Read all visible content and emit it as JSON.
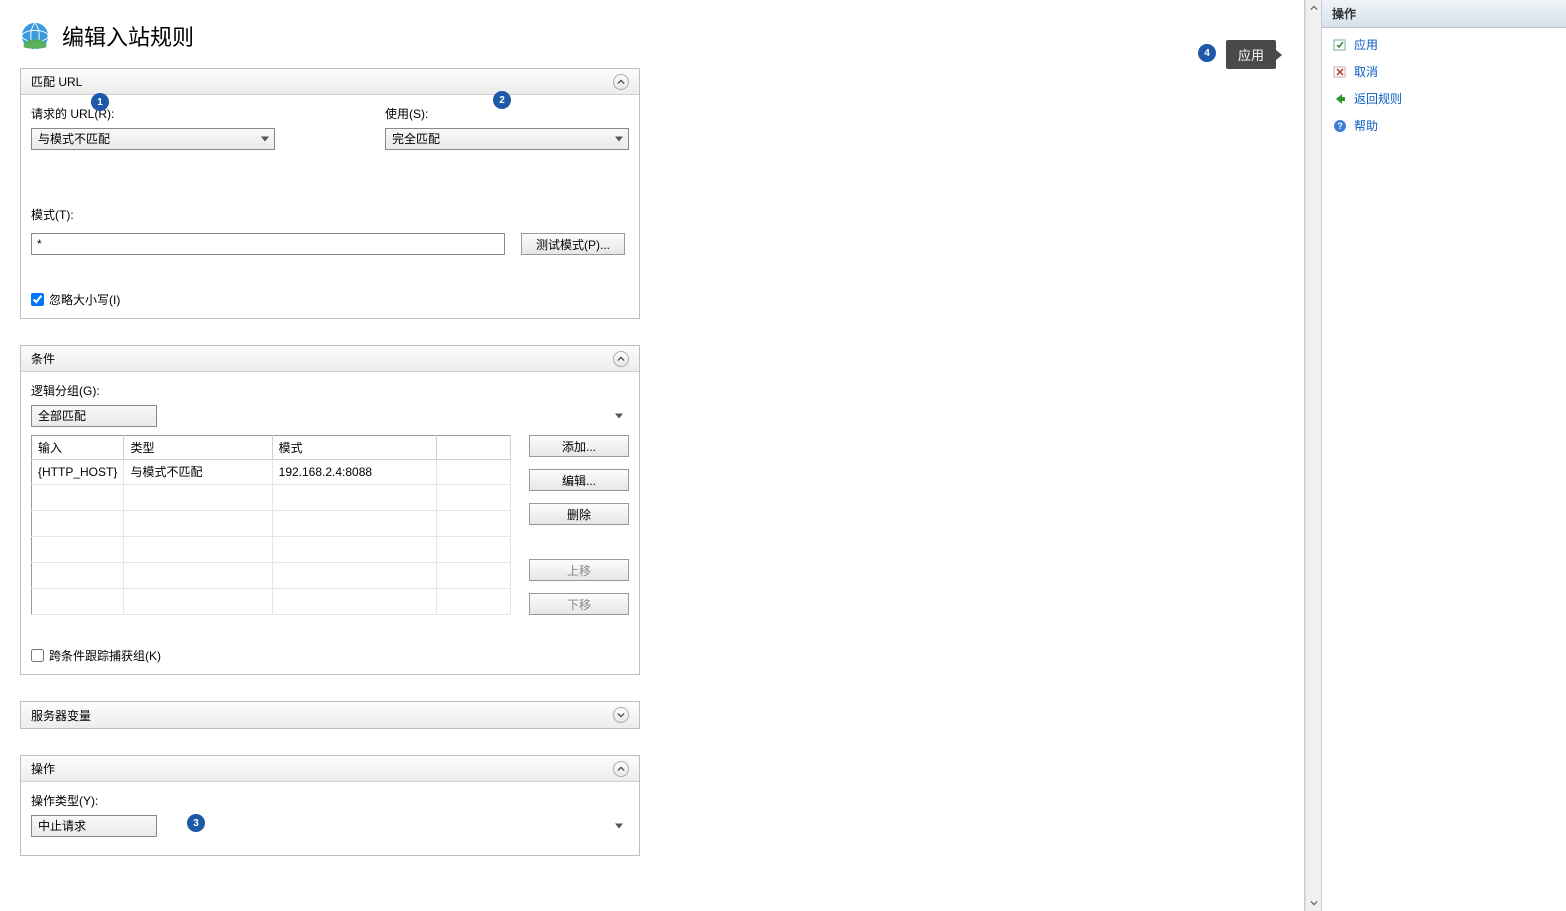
{
  "page": {
    "title": "编辑入站规则"
  },
  "match_url": {
    "section_title": "匹配 URL",
    "requested_url_label": "请求的 URL(R):",
    "requested_url_value": "与模式不匹配",
    "using_label": "使用(S):",
    "using_value": "完全匹配",
    "pattern_label": "模式(T):",
    "pattern_value": "*",
    "test_pattern_btn": "测试模式(P)...",
    "ignore_case_label": "忽略大小写(I)",
    "ignore_case_checked": true
  },
  "conditions": {
    "section_title": "条件",
    "logic_group_label": "逻辑分组(G):",
    "logic_group_value": "全部匹配",
    "columns": {
      "input": "输入",
      "type": "类型",
      "pattern": "模式"
    },
    "rows": [
      {
        "input": "{HTTP_HOST}",
        "type": "与模式不匹配",
        "pattern": "192.168.2.4:8088"
      }
    ],
    "buttons": {
      "add": "添加...",
      "edit": "编辑...",
      "remove": "删除",
      "move_up": "上移",
      "move_down": "下移"
    },
    "track_capture_label": "跨条件跟踪捕获组(K)",
    "track_capture_checked": false
  },
  "server_vars": {
    "section_title": "服务器变量"
  },
  "action": {
    "section_title": "操作",
    "action_type_label": "操作类型(Y):",
    "action_type_value": "中止请求"
  },
  "actions_panel": {
    "header": "操作",
    "apply": "应用",
    "cancel": "取消",
    "back": "返回规则",
    "help": "帮助"
  },
  "annotations": {
    "a1": "1",
    "a2": "2",
    "a3": "3",
    "a4": "4",
    "apply_tooltip": "应用"
  }
}
